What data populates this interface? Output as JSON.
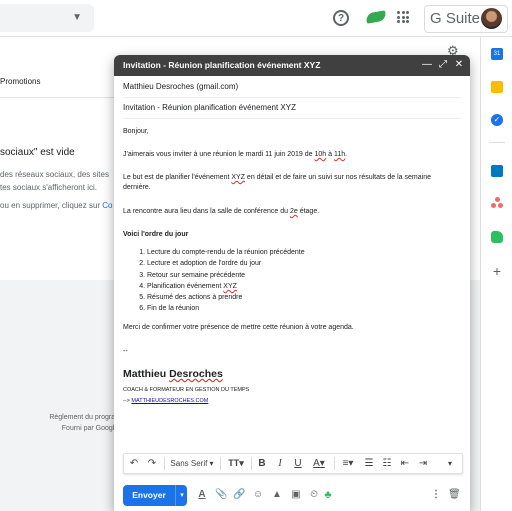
{
  "topbar": {
    "gsuite_label": "G Suite",
    "icons": [
      "help-icon",
      "addon-icon",
      "apps-icon",
      "avatar"
    ]
  },
  "inbox": {
    "tab_promotions": "Promotions",
    "empty_title": "sociaux\" est vide",
    "empty_desc_1": "des réseaux sociaux, des sites",
    "empty_desc_2": "tes sociaux s'afficheront ici.",
    "delete_prefix": "ou en supprimer, cliquez sur ",
    "delete_link": "Co",
    "program_rules": "Règlement du programme",
    "powered_by": "Fourni par Google"
  },
  "compose": {
    "title": "Invitation - Réunion planification événement XYZ",
    "recipient": "Matthieu Desroches (gmail.com)",
    "subject": "Invitation - Réunion planification événement XYZ",
    "body": {
      "greeting": "Bonjour,",
      "p1_a": "J'aimerais vous inviter à une réunion le mardi 11 juin 2019 de ",
      "p1_time1": "10h",
      "p1_mid": " à ",
      "p1_time2": "11h",
      "p1_end": ".",
      "p2_a": "Le but est de planifier l'événement ",
      "p2_xyz": "XYZ",
      "p2_b": " en détail et de faire un suivi sur nos résultats de la semaine dernière.",
      "p3_a": "La rencontre aura lieu dans la salle de conférence du ",
      "p3_floor": "2e",
      "p3_b": " étage.",
      "agenda_title": "Voici l'ordre du jour",
      "agenda": [
        "Lecture du compte-rendu de la réunion précédente",
        "Lecture et adoption de l'ordre du jour",
        "Retour sur semaine précédente",
        "Planification événement ",
        "Résumé des actions à prendre",
        "Fin de la réunion"
      ],
      "agenda_xyz": "XYZ",
      "closing": "Merci de confirmer votre présence de mettre cette réunion à votre agenda."
    },
    "signature": {
      "dashes": "--",
      "name_first": "Matthieu ",
      "name_last": "Desroches",
      "role": "COACH & FORMATEUR EN GESTION DU TEMPS",
      "arrow": "--> ",
      "url": "MATTHIEUDESROCHES.COM"
    },
    "toolbar": {
      "font": "Sans Serif"
    },
    "send_label": "Envoyer"
  },
  "colors": {
    "accent": "#1a73e8",
    "header_bg": "#404040",
    "spell_underline": "#d93025"
  }
}
